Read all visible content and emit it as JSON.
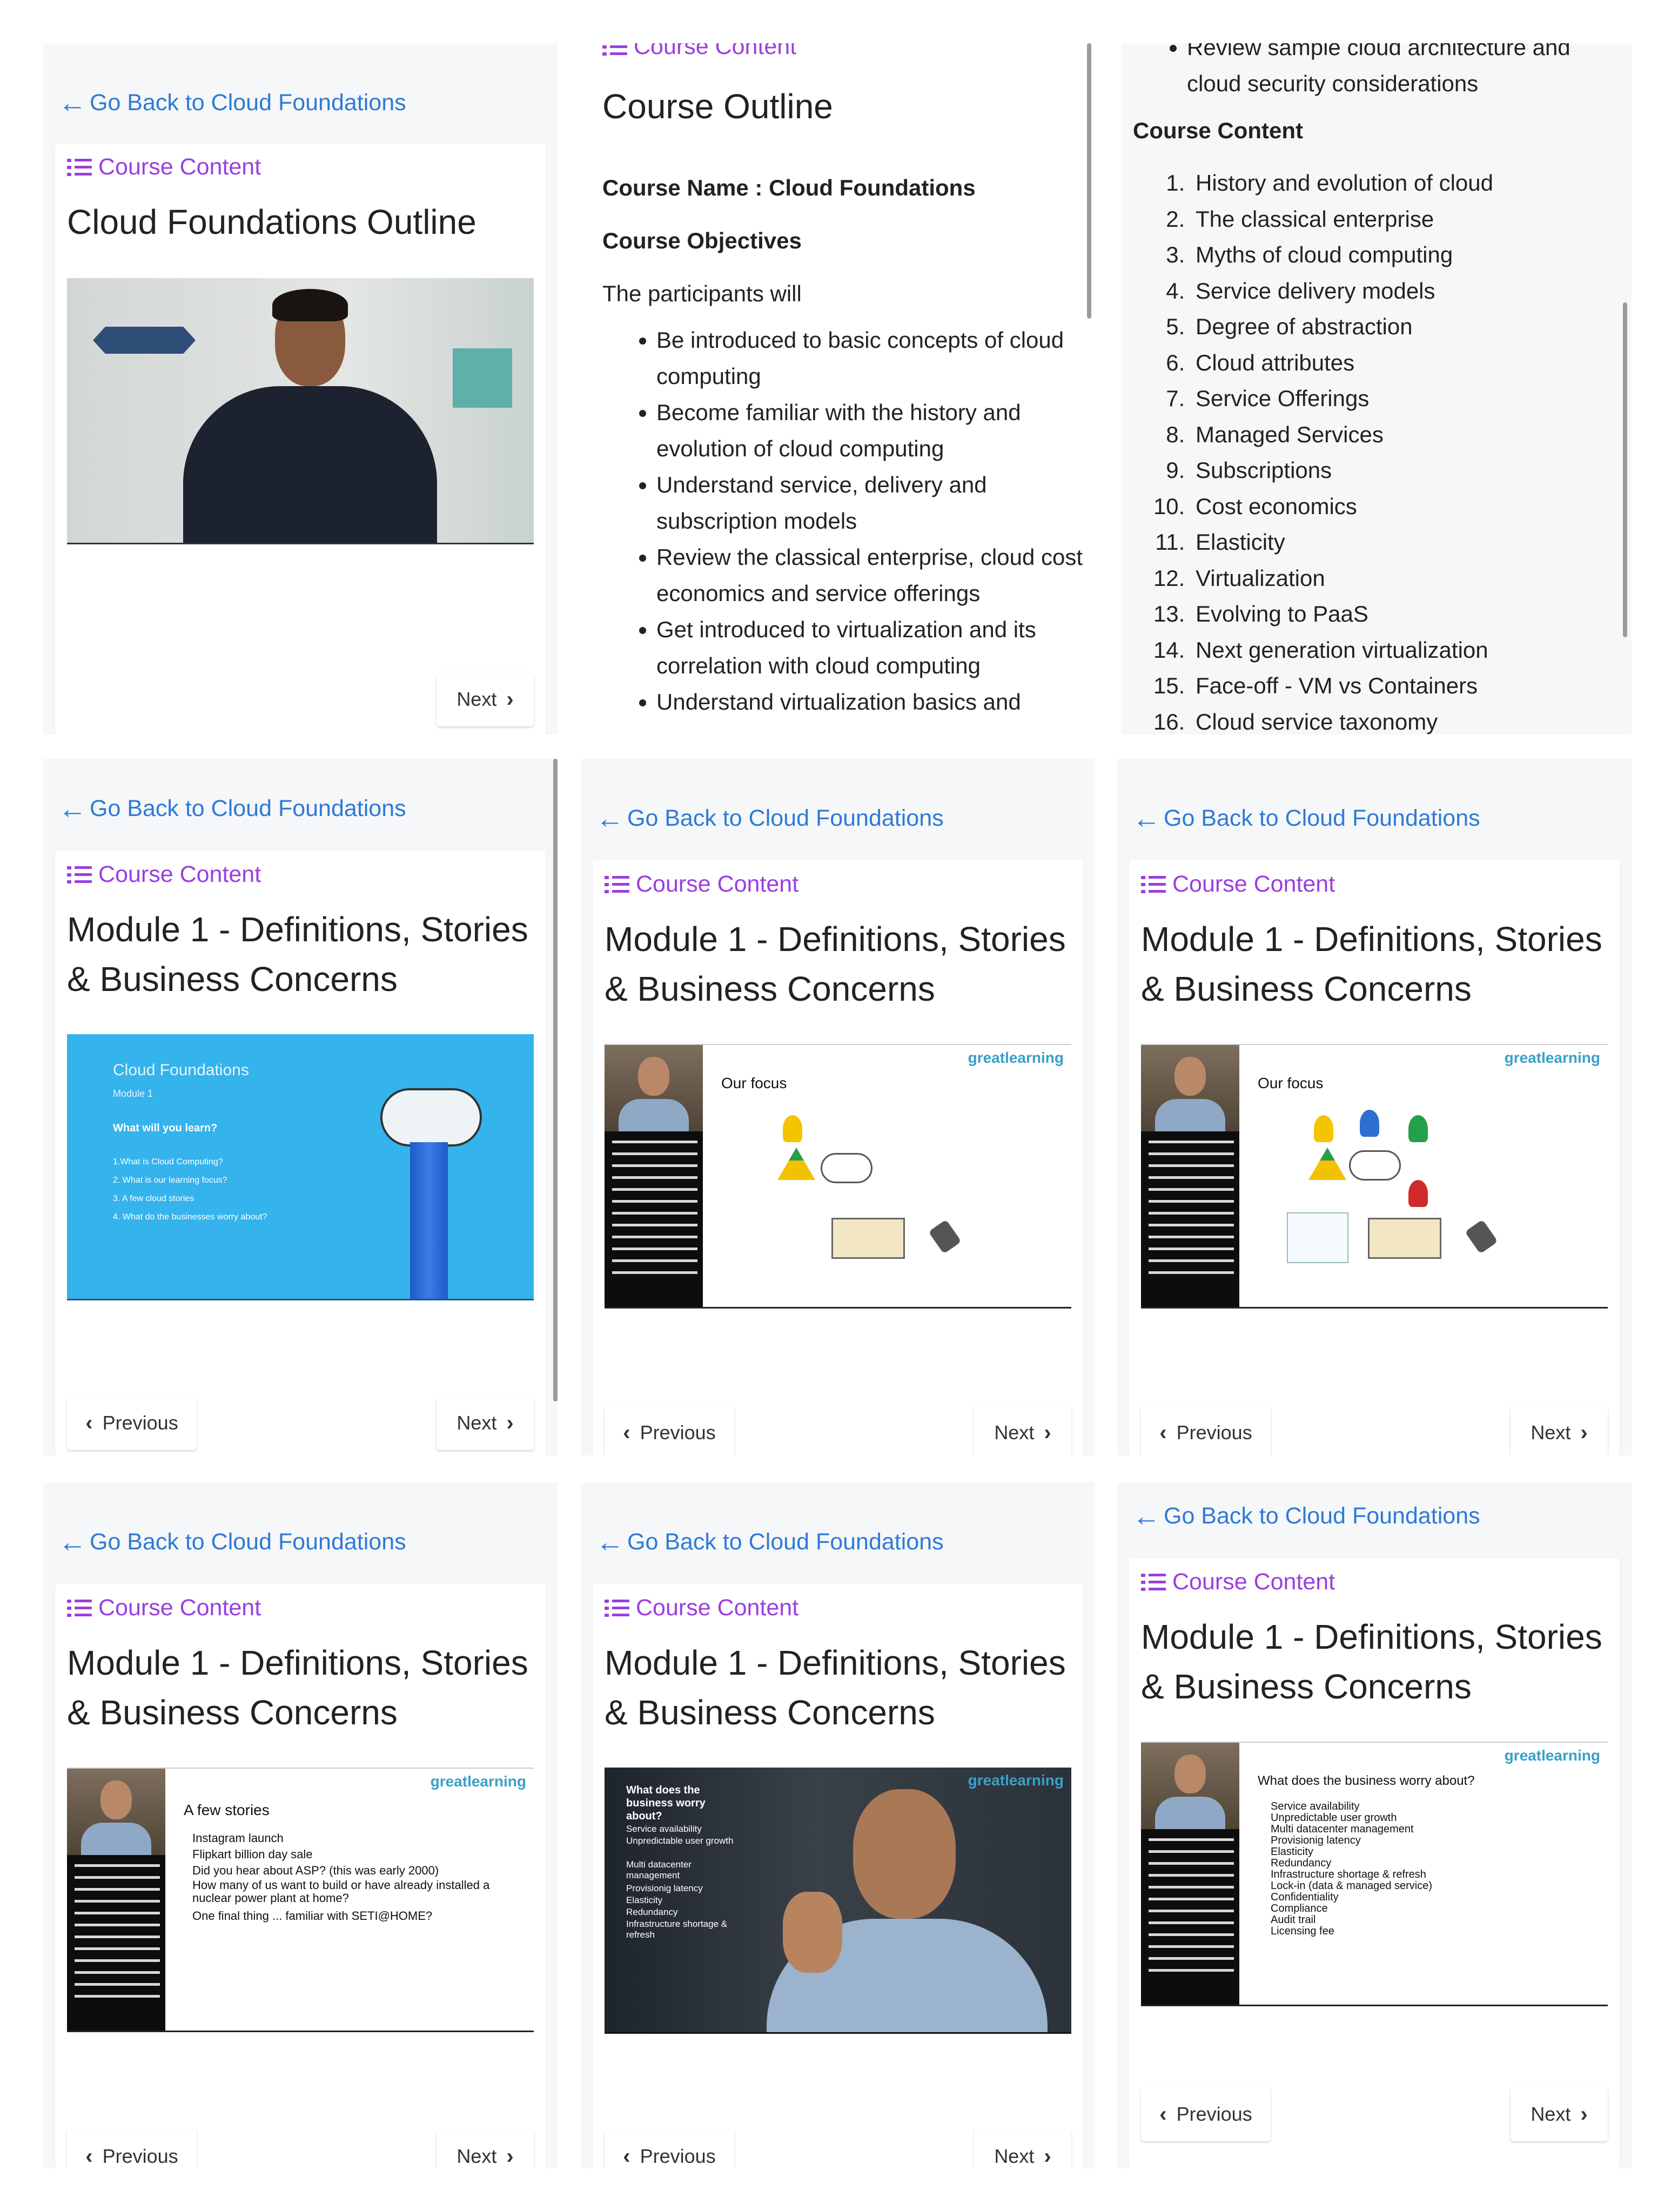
{
  "common": {
    "back_label": "Go Back to Cloud Foundations",
    "course_content_label": "Course Content",
    "previous_label": "Previous",
    "next_label": "Next"
  },
  "panel1": {
    "title": "Cloud Foundations Outline"
  },
  "panel2": {
    "heading": "Course Outline",
    "course_name": "Course Name : Cloud Foundations",
    "objectives_heading": "Course Objectives",
    "intro": "The participants will",
    "objectives": [
      "Be introduced to basic concepts of cloud computing",
      "Become familiar with the history and evolution of cloud computing",
      "Understand service, delivery and subscription models",
      "Review the classical enterprise, cloud cost economics and service offerings",
      "Get introduced to virtualization and its correlation with cloud computing",
      "Understand virtualization basics and"
    ]
  },
  "panel3": {
    "top_item": "Review sample cloud architecture and cloud security considerations",
    "content_heading": "Course Content",
    "items": [
      "History and evolution of cloud",
      "The classical enterprise",
      "Myths of cloud computing",
      "Service delivery models",
      "Degree of abstraction",
      "Cloud attributes",
      "Service Offerings",
      "Managed Services",
      "Subscriptions",
      "Cost economics",
      "Elasticity",
      "Virtualization",
      "Evolving to PaaS",
      "Next generation virtualization",
      "Face-off - VM vs Containers",
      "Cloud service taxonomy"
    ]
  },
  "module_title": "Module 1 - Definitions, Stories & Business Concerns",
  "slides": {
    "intro": {
      "brand": "Cloud Foundations",
      "module": "Module 1",
      "question": "What will you learn?",
      "items": [
        "1.What is Cloud Computing?",
        "2. What is our learning focus?",
        "3. A few cloud stories",
        "4. What do the businesses worry about?"
      ]
    },
    "focus": {
      "logo": "greatlearning",
      "title": "Our focus"
    },
    "stories": {
      "logo": "greatlearning",
      "title": "A few stories",
      "items": [
        "Instagram launch",
        "Flipkart billion day sale",
        "Did you hear about ASP? (this was early 2000)",
        "How many of us want to build or have already installed a nuclear power plant at home?",
        "One final thing ... familiar with SETI@HOME?"
      ]
    },
    "video": {
      "logo": "greatlearning",
      "title": "What does the business worry about?",
      "items": [
        "Service availability",
        "Unpredictable user growth",
        "Multi datacenter management",
        "Provisionig latency",
        "Elasticity",
        "Redundancy",
        "Infrastructure shortage & refresh"
      ]
    },
    "worry": {
      "logo": "greatlearning",
      "title": "What does the business worry about?",
      "items": [
        "Service availability",
        "Unpredictable user growth",
        "Multi datacenter management",
        "Provisionig latency",
        "Elasticity",
        "Redundancy",
        "Infrastructure shortage & refresh",
        "Lock-in (data & managed service)",
        "Confidentiality",
        "Compliance",
        "Audit trail",
        "Licensing fee"
      ]
    }
  }
}
